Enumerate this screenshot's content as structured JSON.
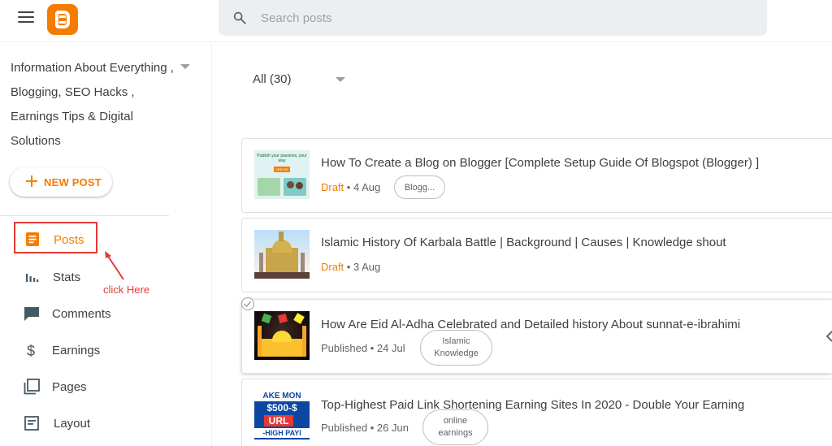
{
  "search": {
    "placeholder": "Search posts"
  },
  "sidebar": {
    "blog_title": "Information About Everything , Blogging, SEO Hacks , Earnings Tips & Digital Solutions",
    "new_post_label": "NEW POST",
    "items": [
      {
        "label": "Posts",
        "icon": "posts-icon",
        "active": true
      },
      {
        "label": "Stats",
        "icon": "stats-icon"
      },
      {
        "label": "Comments",
        "icon": "comment-icon"
      },
      {
        "label": "Earnings",
        "icon": "dollar-icon"
      },
      {
        "label": "Pages",
        "icon": "pages-icon"
      },
      {
        "label": "Layout",
        "icon": "layout-icon"
      }
    ]
  },
  "annotation": {
    "text": "click Here"
  },
  "main": {
    "filter_label": "All (30)",
    "posts": [
      {
        "title": "How To Create a Blog on Blogger [Complete Setup Guide Of Blogspot (Blogger) ]",
        "status": "Draft",
        "date": "4 Aug",
        "label": "Blogg..."
      },
      {
        "title": "Islamic History Of Karbala Battle | Background | Causes | Knowledge shout",
        "status": "Draft",
        "date": "3 Aug",
        "label": ""
      },
      {
        "title": "How Are Eid Al-Adha Celebrated and Detailed history About sunnat-e-ibrahimi",
        "status": "Published",
        "date": "24 Jul",
        "label_line1": "Islamic",
        "label_line2": "Knowledge"
      },
      {
        "title": "Top-Highest Paid Link Shortening Earning Sites In 2020 - Double Your Earning",
        "status": "Published",
        "date": "26 Jun",
        "label_line1": "online",
        "label_line2": "earnings"
      }
    ],
    "thumb_text": {
      "t1_heading": "Publish your passions, your way",
      "t1_button": "CREATE",
      "t4_line1": "AKE MON",
      "t4_line2": "$500-$",
      "t4_line3": "URL",
      "t4_line4": "-HIGH PAYI"
    }
  },
  "colors": {
    "accent": "#f57c00",
    "annotation": "#e53935"
  }
}
